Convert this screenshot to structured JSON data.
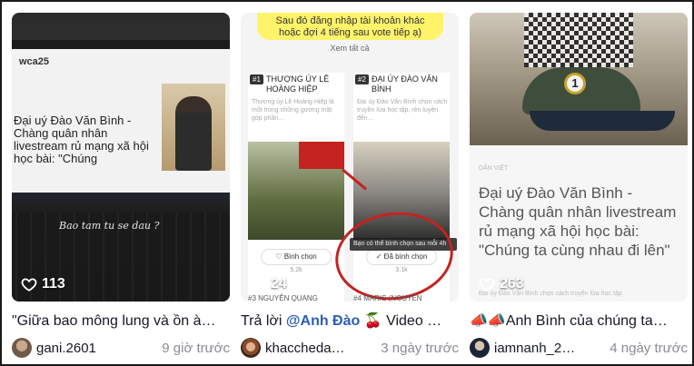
{
  "cards": [
    {
      "likes": "113",
      "caption": "\"Giữa bao mông lung và ồn à…",
      "username": "gani.2601",
      "time": "9 giờ trước",
      "thumb": {
        "site": "wca25",
        "headline": "Đại uý Đào Văn Bình - Chàng quân nhân livestream rủ mạng xã hội học bài: \"Chúng",
        "handwriting": "Bao tam tu se dau ?"
      }
    },
    {
      "likes": "24",
      "caption_prefix": "Trả lời ",
      "caption_mention": "@Anh Đào",
      "caption_suffix": " 🍒 Video …",
      "username": "khacchedа…",
      "time": "3 ngày trước",
      "thumb": {
        "banner": "Sau đó đăng nhập tài khoản khác hoặc đợi 4 tiếng sau vote tiếp ạ)",
        "see_all": "Xem tất cả",
        "candidate_a_rank": "#1",
        "candidate_a_name": "THƯỢNG ÚY LÊ HOÀNG HIỆP",
        "candidate_a_desc": "Thượng úy Lê Hoàng Hiệp là một trong những gương mặt góp phần…",
        "candidate_a_vote": "Bình chọn",
        "candidate_a_count": "5.2k",
        "candidate_b_rank": "#2",
        "candidate_b_name": "ĐẠI ÚY ĐÀO VĂN BÌNH",
        "candidate_b_desc": "Đại úy Đào Văn Bình chọn cách truyền lửa học tập, rèn luyện đến…",
        "candidate_b_vote": "Đã bình chọn",
        "candidate_b_count": "3.1k",
        "tooltip": "Bạn có thể bình chọn sau mỗi 4h",
        "next_a": "#3 NGUYỄN QUANG",
        "next_b": "#4 MARIS (NGUYỄN"
      }
    },
    {
      "likes": "263",
      "caption": "📣📣Anh Bình của chúng ta…",
      "username": "iamnanh_2…",
      "time": "4 ngày trước",
      "thumb": {
        "badge": "1",
        "source": "DÂN VIỆT",
        "headline": "Đại uý Đào Văn Bình - Chàng quân nhân livestream rủ mạng xã hội học bài: \"Chúng ta cùng nhau đi lên\"",
        "sub": "Đại úy Đào Văn Bình chọn cách truyền lửa học tập"
      }
    }
  ],
  "colors": {
    "mention": "#2b5db9",
    "time": "#8a8b91",
    "banner": "#fff36a",
    "highlight": "#c4231f"
  }
}
